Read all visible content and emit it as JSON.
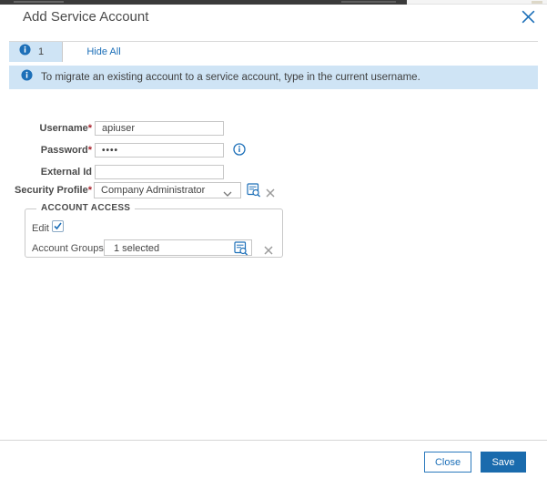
{
  "colors": {
    "accent": "#1c6fb8",
    "save_button_bg": "#1a6bad",
    "banner_bg": "#cfe4f5",
    "top_strip_dark": "#3b3b3b",
    "required_marker": "#a8232d"
  },
  "dialog": {
    "title": "Add Service Account"
  },
  "tabs": {
    "info_tab_count": "1",
    "hide_all_label": "Hide All"
  },
  "banner": {
    "message": "To migrate an existing account to a service account, type in the current username."
  },
  "form": {
    "username": {
      "label": "Username",
      "required_marker": "*",
      "value": "apiuser"
    },
    "password": {
      "label": "Password",
      "required_marker": "*",
      "value": "••••"
    },
    "external_id": {
      "label": "External Id",
      "value": ""
    },
    "security_profile": {
      "label": "Security Profile",
      "required_marker": "*",
      "selected_option": "Company Administrator"
    },
    "account_access": {
      "legend": "ACCOUNT ACCESS",
      "edit_checkbox": {
        "label": "Edit",
        "checked": true
      },
      "account_groups": {
        "label": "Account Groups",
        "required_marker": "*",
        "value": "1 selected"
      }
    }
  },
  "footer": {
    "close_label": "Close",
    "save_label": "Save"
  }
}
